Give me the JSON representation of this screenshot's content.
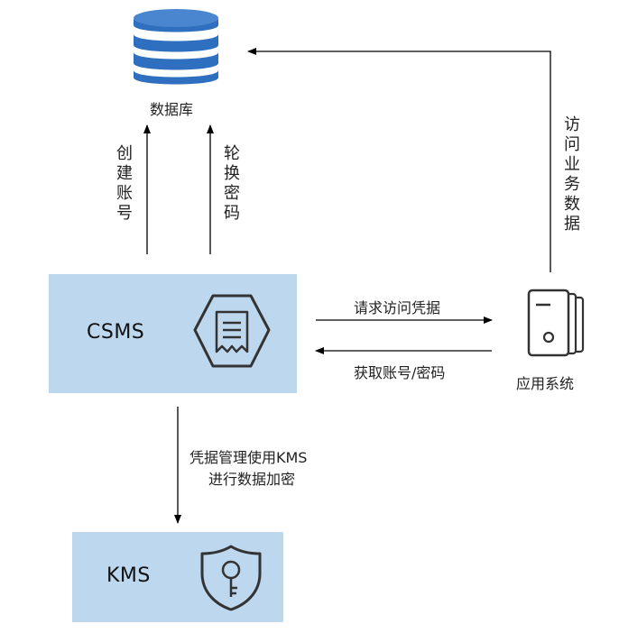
{
  "database": {
    "label": "数据库",
    "icon": "database-icon"
  },
  "csms": {
    "label": "CSMS",
    "icon": "receipt-hexagon-icon"
  },
  "kms": {
    "label": "KMS",
    "icon": "key-shield-icon"
  },
  "app": {
    "label": "应用系统",
    "icon": "server-icon"
  },
  "edges": {
    "create_account": "创建账号",
    "rotate_password": "轮换密码",
    "access_business_data": "访问业务数据",
    "request_credential": "请求访问凭据",
    "get_account_password": "获取账号/密码",
    "kms_line1": "凭据管理使用KMS",
    "kms_line2": "进行数据加密"
  },
  "colors": {
    "box_fill": "#bdd7ee",
    "line": "#000000",
    "icon_stroke": "#333333"
  }
}
